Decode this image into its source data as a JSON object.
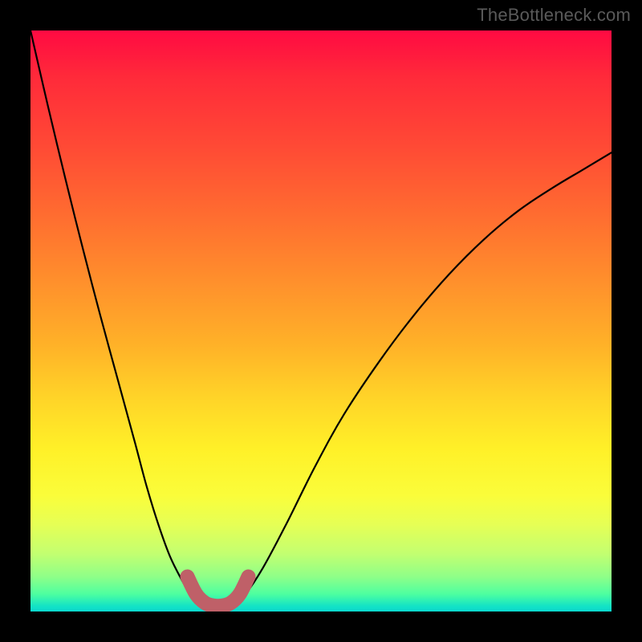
{
  "watermark": "TheBottleneck.com",
  "chart_data": {
    "type": "line",
    "title": "",
    "xlabel": "",
    "ylabel": "",
    "xlim": [
      0,
      1
    ],
    "ylim": [
      0,
      1
    ],
    "background": "red-to-green vertical gradient",
    "series": [
      {
        "name": "left-curve",
        "x": [
          0.0,
          0.03,
          0.06,
          0.09,
          0.12,
          0.15,
          0.18,
          0.2,
          0.22,
          0.24,
          0.26,
          0.275,
          0.285,
          0.295
        ],
        "y": [
          1.0,
          0.87,
          0.745,
          0.625,
          0.51,
          0.4,
          0.29,
          0.215,
          0.15,
          0.095,
          0.055,
          0.03,
          0.018,
          0.012
        ]
      },
      {
        "name": "minimum-arc",
        "x": [
          0.27,
          0.285,
          0.3,
          0.315,
          0.33,
          0.345,
          0.36,
          0.375
        ],
        "y": [
          0.06,
          0.03,
          0.015,
          0.01,
          0.01,
          0.015,
          0.03,
          0.06
        ]
      },
      {
        "name": "right-curve",
        "x": [
          0.35,
          0.37,
          0.4,
          0.44,
          0.49,
          0.54,
          0.6,
          0.66,
          0.72,
          0.78,
          0.84,
          0.9,
          0.95,
          1.0
        ],
        "y": [
          0.012,
          0.03,
          0.075,
          0.15,
          0.25,
          0.34,
          0.43,
          0.51,
          0.58,
          0.64,
          0.69,
          0.73,
          0.76,
          0.79
        ]
      }
    ],
    "gradient_stops": [
      {
        "pos": 0.0,
        "color": "#ff0a42"
      },
      {
        "pos": 0.08,
        "color": "#ff2a3a"
      },
      {
        "pos": 0.2,
        "color": "#ff4a35"
      },
      {
        "pos": 0.32,
        "color": "#ff6d30"
      },
      {
        "pos": 0.43,
        "color": "#ff8f2c"
      },
      {
        "pos": 0.54,
        "color": "#ffb128"
      },
      {
        "pos": 0.63,
        "color": "#ffd328"
      },
      {
        "pos": 0.72,
        "color": "#fff028"
      },
      {
        "pos": 0.8,
        "color": "#fafd3a"
      },
      {
        "pos": 0.85,
        "color": "#e6ff55"
      },
      {
        "pos": 0.9,
        "color": "#c3ff70"
      },
      {
        "pos": 0.94,
        "color": "#8fff88"
      },
      {
        "pos": 0.97,
        "color": "#4dffa0"
      },
      {
        "pos": 0.99,
        "color": "#15e4c4"
      },
      {
        "pos": 1.0,
        "color": "#0ad8cf"
      }
    ],
    "styles": {
      "thin_curve": {
        "stroke": "#000000",
        "width": 2.2
      },
      "thick_arc": {
        "stroke": "#bf6068",
        "width": 18,
        "cap": "round"
      }
    }
  }
}
